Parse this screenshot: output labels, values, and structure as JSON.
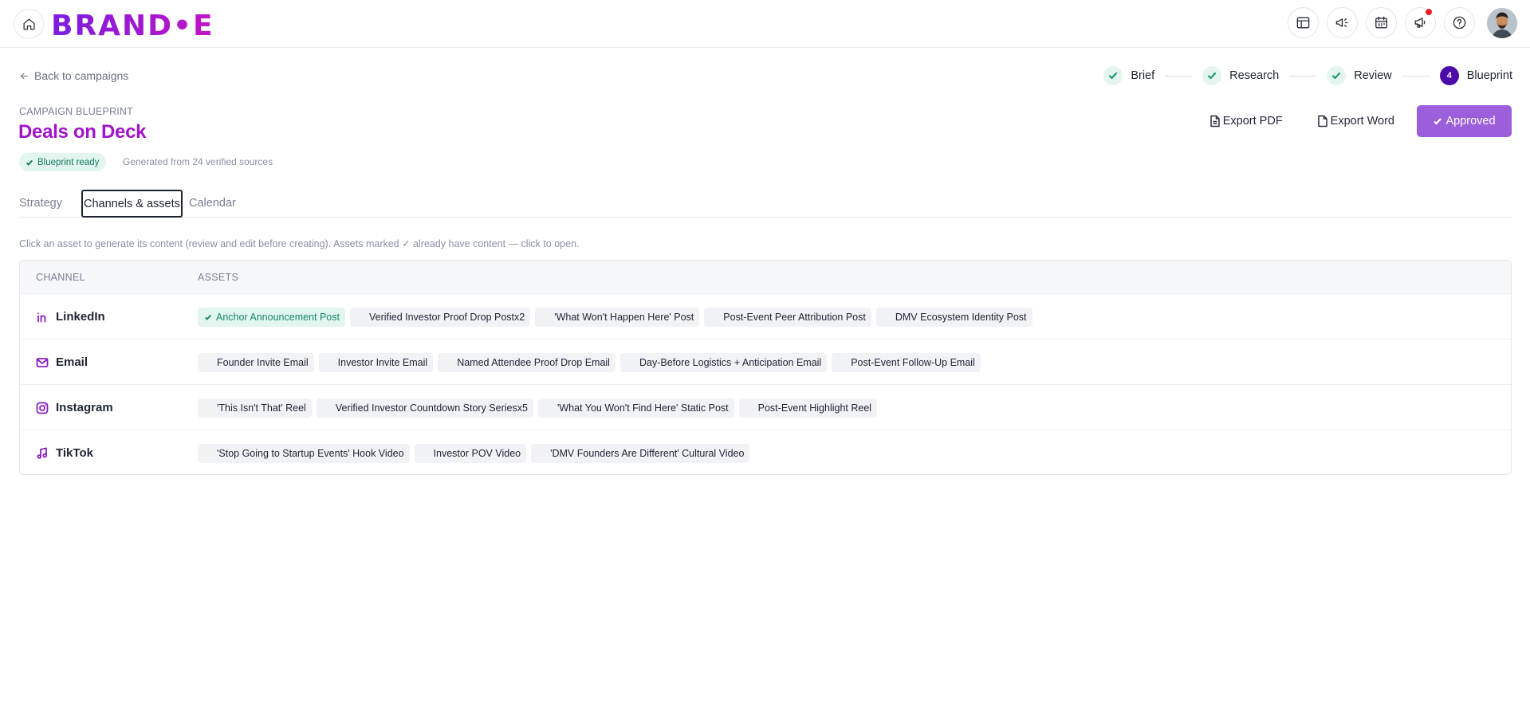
{
  "header": {
    "logo_text": "BRAND•E",
    "icons": [
      "layout-icon",
      "megaphone-sparkle-icon",
      "calendar-icon",
      "announcement-icon",
      "help-icon"
    ],
    "brand_color": "#a114c9"
  },
  "nav": {
    "back_label": "Back to campaigns"
  },
  "stepper": {
    "steps": [
      {
        "label": "Brief",
        "status": "done"
      },
      {
        "label": "Research",
        "status": "done"
      },
      {
        "label": "Review",
        "status": "done"
      },
      {
        "label": "Blueprint",
        "status": "active",
        "number": "4"
      }
    ]
  },
  "page": {
    "eyebrow": "CAMPAIGN BLUEPRINT",
    "title": "Deals on Deck",
    "badge": "Blueprint ready",
    "generated": "Generated from 24 verified sources"
  },
  "actions": {
    "export_pdf": "Export PDF",
    "export_word": "Export Word",
    "approved": "Approved"
  },
  "tabs": [
    {
      "label": "Strategy",
      "active": false
    },
    {
      "label": "Channels & assets",
      "active": true
    },
    {
      "label": "Calendar",
      "active": false
    }
  ],
  "hint": "Click an asset to generate its content (review and edit before creating). Assets marked ✓ already have content — click to open.",
  "table": {
    "headers": [
      "CHANNEL",
      "ASSETS"
    ],
    "rows": [
      {
        "channel": "LinkedIn",
        "icon": "linkedin-icon",
        "assets": [
          {
            "label": "Anchor Announcement Post",
            "done": true
          },
          {
            "label": "Verified Investor Proof Drop Postx2",
            "done": false
          },
          {
            "label": "'What Won't Happen Here' Post",
            "done": false
          },
          {
            "label": "Post-Event Peer Attribution Post",
            "done": false
          },
          {
            "label": "DMV Ecosystem Identity Post",
            "done": false
          }
        ]
      },
      {
        "channel": "Email",
        "icon": "mail-icon",
        "assets": [
          {
            "label": "Founder Invite Email",
            "done": false
          },
          {
            "label": "Investor Invite Email",
            "done": false
          },
          {
            "label": "Named Attendee Proof Drop Email",
            "done": false
          },
          {
            "label": "Day-Before Logistics + Anticipation Email",
            "done": false
          },
          {
            "label": "Post-Event Follow-Up Email",
            "done": false
          }
        ]
      },
      {
        "channel": "Instagram",
        "icon": "instagram-icon",
        "assets": [
          {
            "label": "'This Isn't That' Reel",
            "done": false
          },
          {
            "label": "Verified Investor Countdown Story Seriesx5",
            "done": false
          },
          {
            "label": "'What You Won't Find Here' Static Post",
            "done": false
          },
          {
            "label": "Post-Event Highlight Reel",
            "done": false
          }
        ]
      },
      {
        "channel": "TikTok",
        "icon": "music-note-icon",
        "assets": [
          {
            "label": "'Stop Going to Startup Events' Hook Video",
            "done": false
          },
          {
            "label": "Investor POV Video",
            "done": false
          },
          {
            "label": "'DMV Founders Are Different' Cultural Video",
            "done": false
          }
        ]
      }
    ]
  }
}
